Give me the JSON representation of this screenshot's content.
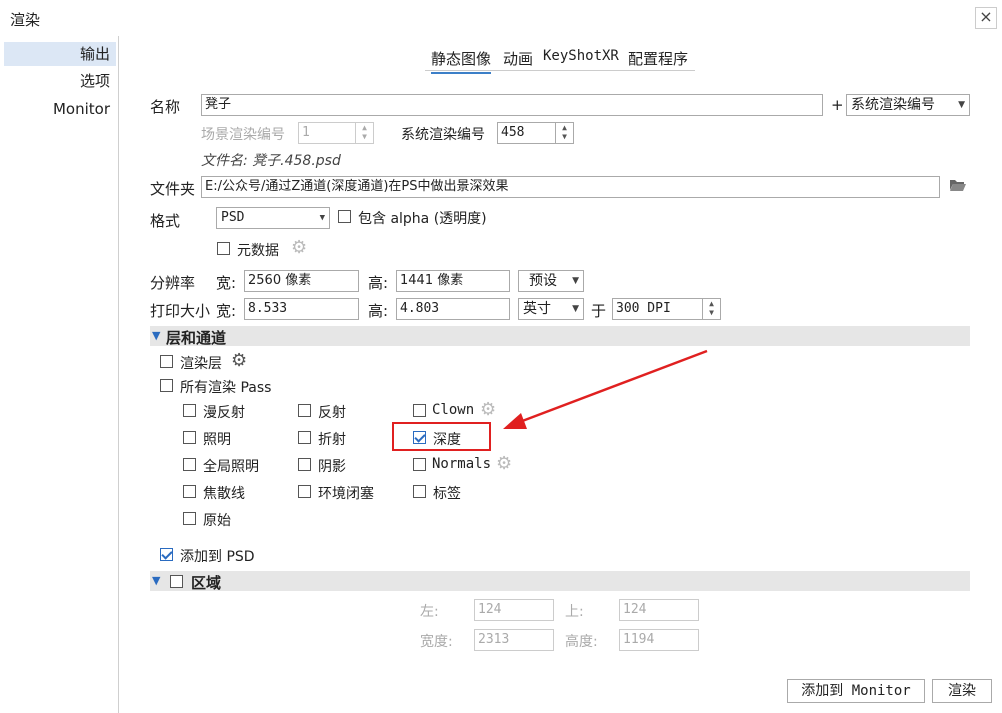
{
  "window": {
    "title": "渲染",
    "close_label": "×"
  },
  "sidebar": {
    "items": [
      "输出",
      "选项",
      "Monitor"
    ]
  },
  "tabs": [
    "静态图像",
    "动画",
    "KeyShotXR",
    "配置程序"
  ],
  "name": {
    "label": "名称",
    "value": "凳子",
    "plus": "+",
    "suffix_select": "系统渲染编号"
  },
  "scene_num": {
    "label": "场景渲染编号",
    "value": "1"
  },
  "system_num": {
    "label": "系统渲染编号",
    "value": "458"
  },
  "filename": {
    "text": "文件名: 凳子.458.psd"
  },
  "folder": {
    "label": "文件夹",
    "value": "E:/公众号/通过Z通道(深度通道)在PS中做出景深效果"
  },
  "format": {
    "label": "格式",
    "value": "PSD",
    "alpha_label": "包含 alpha (透明度)",
    "metadata_label": "元数据"
  },
  "resolution": {
    "label": "分辨率",
    "w_label": "宽:",
    "w_value": "2560 像素",
    "h_label": "高:",
    "h_value": "1441 像素",
    "preset": "预设"
  },
  "print_size": {
    "label": "打印大小",
    "w_label": "宽:",
    "w_value": "8.533",
    "h_label": "高:",
    "h_value": "4.803",
    "unit": "英寸",
    "at_label": "于",
    "dpi": "300 DPI"
  },
  "layers": {
    "title": "层和通道",
    "render_layers": "渲染层",
    "all_passes": "所有渲染 Pass",
    "col1": [
      "漫反射",
      "照明",
      "全局照明",
      "焦散线",
      "原始"
    ],
    "col2": [
      "反射",
      "折射",
      "阴影",
      "环境闭塞"
    ],
    "col3": [
      "Clown",
      "深度",
      "Normals",
      "标签"
    ],
    "add_psd": "添加到 PSD"
  },
  "region": {
    "title": "区域",
    "left_label": "左:",
    "left_value": "124",
    "top_label": "上:",
    "top_value": "124",
    "width_label": "宽度:",
    "width_value": "2313",
    "height_label": "高度:",
    "height_value": "1194"
  },
  "footer": {
    "add_monitor": "添加到 Monitor",
    "render": "渲染"
  },
  "colors": {
    "accent": "#2a6bc0",
    "annotation": "#e02020"
  }
}
